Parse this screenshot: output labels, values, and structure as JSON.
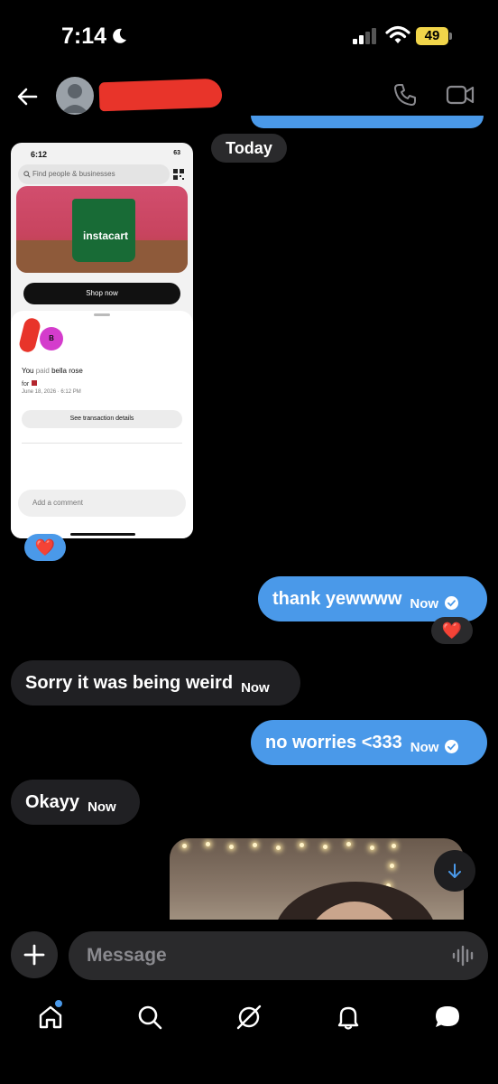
{
  "status_bar": {
    "time": "7:14",
    "battery": "49"
  },
  "conversation": {
    "date_label": "Today"
  },
  "shared_screenshot": {
    "time": "6:12",
    "battery": "63",
    "search_placeholder": "Find people & businesses",
    "brand": "instacart",
    "shop_button": "Shop now",
    "avatar_initial": "B",
    "paid_prefix": "You",
    "paid_verb": "paid",
    "paid_name": "bella rose",
    "for_label": "for",
    "date": "June 18, 2026 · 6:12 PM",
    "details_button": "See transaction details",
    "comment_placeholder": "Add a comment"
  },
  "messages": [
    {
      "side": "out",
      "text": "thank yewwww",
      "time": "Now",
      "seen": true
    },
    {
      "side": "in",
      "text": "Sorry it was being weird",
      "time": "Now"
    },
    {
      "side": "out",
      "text": "no worries <333",
      "time": "Now",
      "seen": true
    },
    {
      "side": "in",
      "text": "Okayy",
      "time": "Now"
    }
  ],
  "reactions": [
    "❤️",
    "❤️"
  ],
  "composer": {
    "placeholder": "Message"
  },
  "icons": [
    "back-icon",
    "phone-icon",
    "video-icon",
    "plus-icon",
    "voice-icon",
    "home-icon",
    "search-icon",
    "grok-icon",
    "notifications-icon",
    "messages-icon"
  ],
  "colors": {
    "outgoing_bubble": "#4a99e9",
    "incoming_bubble": "#202023",
    "background": "#000000",
    "reaction_heart": "#e0283a"
  }
}
